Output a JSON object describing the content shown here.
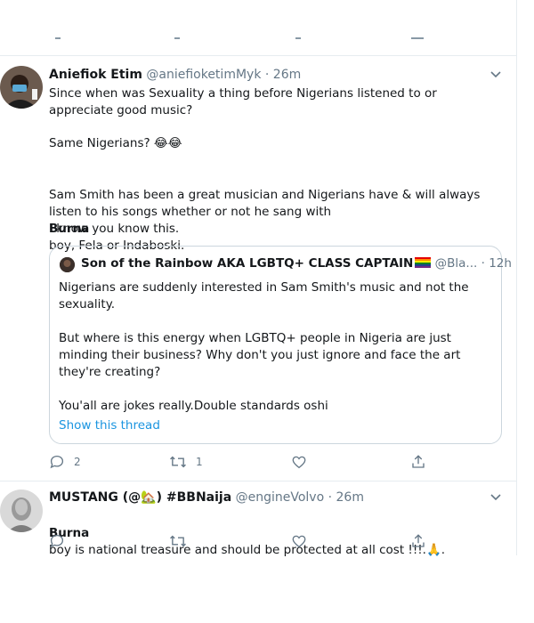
{
  "tweets": [
    {
      "name": "Aniefiok Etim",
      "handle": "@aniefioketimMyk",
      "time": "· 26m",
      "paragraphs": [
        "Since when was Sexuality a thing before Nigerians listened to or appreciate good music?",
        "Same Nigerians? 😂😂",
        "Sam Smith has been a great musician and Nigerians have & will always listen to his songs whether or not he sang with",
        "Burna",
        "boy, Fela or Indaboski.",
        "I know you know this."
      ],
      "quote": {
        "name": "Son of the Rainbow AKA LGBTQ+ CLASS CAPTAIN",
        "handle": "@Bla...",
        "time": "· 12h",
        "lines": [
          "Nigerians are suddenly interested in Sam Smith's music and not the sexuality.",
          "But where is this energy when LGBTQ+ people in Nigeria are just minding their business? Why don't you just ignore and face the art they're creating?",
          "You'all are jokes really.Double standards oshi"
        ],
        "show_thread": "Show this thread"
      },
      "actions": {
        "reply_count": "2",
        "retweet_count": "1"
      }
    },
    {
      "name": "MUSTANG (@🏡) #BBNaija",
      "handle": "@engineVolvo",
      "time": "· 26m",
      "bold_lead": "Burna",
      "text": "boy is national treasure and should be protected at all cost !!!.🙏."
    }
  ],
  "icons": [
    "reply-icon",
    "retweet-icon",
    "like-icon",
    "share-icon",
    "chevron-down-icon"
  ],
  "colors": {
    "link": "#1b95e0",
    "muted": "#657786",
    "border": "#e6ecf0"
  }
}
